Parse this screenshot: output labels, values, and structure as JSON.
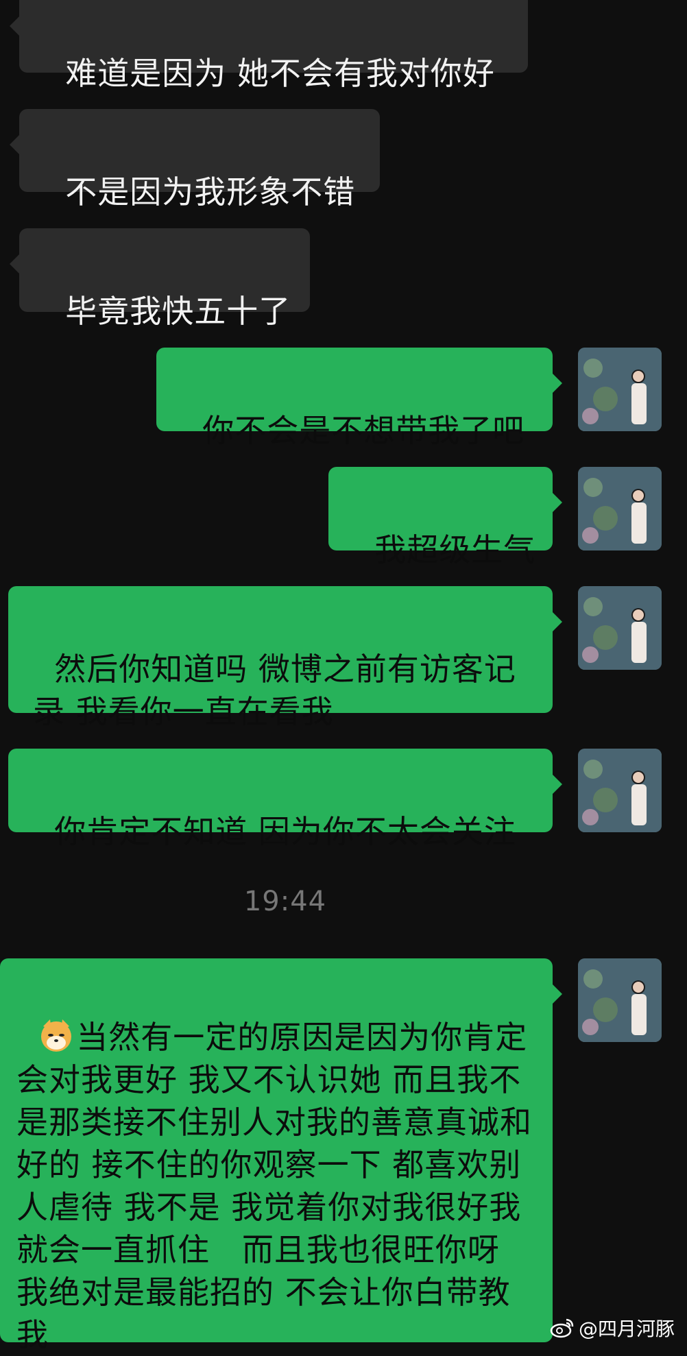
{
  "messages": [
    {
      "side": "in",
      "text": "难道是因为 她不会有我对你好"
    },
    {
      "side": "in",
      "text": "不是因为我形象不错"
    },
    {
      "side": "in",
      "text": "毕竟我快五十了"
    },
    {
      "side": "out",
      "text": "你不会是不想带我了吧"
    },
    {
      "side": "out",
      "text": "我超级生气"
    },
    {
      "side": "out",
      "text": "然后你知道吗 微博之前有访客记录 我看你一直在看我"
    },
    {
      "side": "out",
      "text": "你肯定不知道 因为你不太会关注"
    },
    {
      "side": "out",
      "text": "当然有一定的原因是因为你肯定会对我更好 我又不认识她 而且我不是那类接不住别人对我的善意真诚和好的 接不住的你观察一下 都喜欢别人虐待 我不是 我觉着你对我很好我就会一直抓住   而且我也很旺你呀 我绝对是最能招的 不会让你白带教我"
    }
  ],
  "timestamp": "19:44",
  "watermark": "@四月河豚",
  "icons": {
    "avatar": "avatar-icon",
    "emoji": "doge-emoji-icon",
    "watermark": "weibo-icon"
  },
  "colors": {
    "background": "#0f0f0f",
    "incoming": "#2c2c2c",
    "outgoing": "#27b25a"
  }
}
